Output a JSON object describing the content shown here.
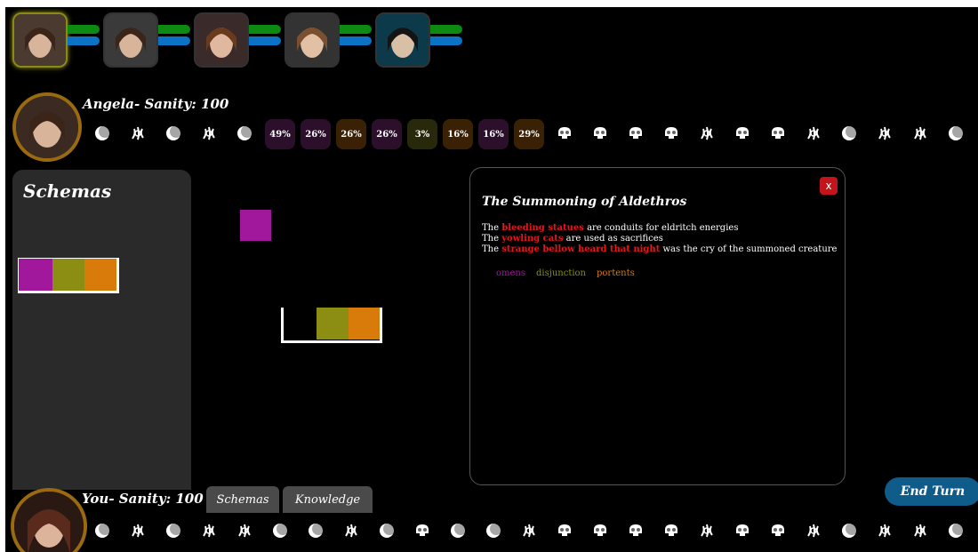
{
  "colors": {
    "purple": "#a2189c",
    "orange": "#d97b0a",
    "olive": "#8b8e12",
    "sanity_green": "#0c8a12",
    "sanity_blue": "#0a73c6",
    "close_red": "#c2141a",
    "end_turn_blue": "#0f5b8a"
  },
  "characters": [
    {
      "name": "Angela",
      "icon": "character-portrait",
      "active": true
    },
    {
      "name": "",
      "icon": "character-portrait",
      "active": false
    },
    {
      "name": "",
      "icon": "character-portrait",
      "active": false
    },
    {
      "name": "",
      "icon": "character-portrait",
      "active": false
    },
    {
      "name": "",
      "icon": "character-portrait",
      "active": false
    }
  ],
  "opponent": {
    "label": "Angela- Sanity: 100",
    "cards": [
      {
        "kind": "moon",
        "color": "purple"
      },
      {
        "kind": "tentacle",
        "color": "orange"
      },
      {
        "kind": "moon",
        "color": "purple"
      },
      {
        "kind": "tentacle",
        "color": "orange"
      },
      {
        "kind": "moon",
        "color": "purple"
      },
      {
        "kind": "percent",
        "color": "d-pur",
        "text": "49%"
      },
      {
        "kind": "percent",
        "color": "d-pur",
        "text": "26%"
      },
      {
        "kind": "percent",
        "color": "d-ora",
        "text": "26%"
      },
      {
        "kind": "percent",
        "color": "d-pur",
        "text": "26%"
      },
      {
        "kind": "percent",
        "color": "d-oli",
        "text": "3%"
      },
      {
        "kind": "percent",
        "color": "d-ora",
        "text": "16%"
      },
      {
        "kind": "percent",
        "color": "d-pur",
        "text": "16%"
      },
      {
        "kind": "percent",
        "color": "d-ora",
        "text": "29%"
      },
      {
        "kind": "skull",
        "color": "olive"
      },
      {
        "kind": "skull",
        "color": "olive"
      },
      {
        "kind": "skull",
        "color": "olive"
      },
      {
        "kind": "skull",
        "color": "olive"
      },
      {
        "kind": "tentacle",
        "color": "orange"
      },
      {
        "kind": "skull",
        "color": "olive"
      },
      {
        "kind": "skull",
        "color": "olive"
      },
      {
        "kind": "tentacle",
        "color": "orange"
      },
      {
        "kind": "moon",
        "color": "purple"
      },
      {
        "kind": "tentacle",
        "color": "orange"
      },
      {
        "kind": "tentacle",
        "color": "orange"
      },
      {
        "kind": "moon",
        "color": "purple"
      }
    ]
  },
  "schemas": {
    "title": "Schemas"
  },
  "modal": {
    "title": "The Summoning of Aldethros",
    "close_label": "x",
    "lines": [
      {
        "pre": "The ",
        "highlight": "bleeding statues",
        "post": " are conduits for eldritch energies"
      },
      {
        "pre": "The ",
        "highlight": "yowling cats",
        "post": " are used as sacrifices"
      },
      {
        "pre": "The ",
        "highlight": "strange bellow heard that night",
        "post": " was the cry of the summoned creature"
      }
    ],
    "tags": [
      {
        "label": "omens",
        "color": "#a2189c"
      },
      {
        "label": "disjunction",
        "color": "#8b8e12"
      },
      {
        "label": "portents",
        "color": "#d97b0a"
      }
    ]
  },
  "player": {
    "label": "You- Sanity: 100",
    "tabs": [
      "Schemas",
      "Knowledge"
    ],
    "end_turn": "End Turn",
    "cards": [
      {
        "kind": "moon",
        "color": "purple"
      },
      {
        "kind": "tentacle",
        "color": "orange"
      },
      {
        "kind": "moon",
        "color": "purple"
      },
      {
        "kind": "tentacle",
        "color": "orange"
      },
      {
        "kind": "tentacle",
        "color": "orange"
      },
      {
        "kind": "moon",
        "color": "purple"
      },
      {
        "kind": "moon",
        "color": "purple"
      },
      {
        "kind": "tentacle",
        "color": "orange"
      },
      {
        "kind": "moon",
        "color": "purple"
      },
      {
        "kind": "skull",
        "color": "olive"
      },
      {
        "kind": "moon",
        "color": "purple"
      },
      {
        "kind": "moon",
        "color": "purple"
      },
      {
        "kind": "tentacle",
        "color": "orange"
      },
      {
        "kind": "skull",
        "color": "olive"
      },
      {
        "kind": "skull",
        "color": "olive"
      },
      {
        "kind": "skull",
        "color": "olive"
      },
      {
        "kind": "skull",
        "color": "olive"
      },
      {
        "kind": "tentacle",
        "color": "orange"
      },
      {
        "kind": "skull",
        "color": "olive"
      },
      {
        "kind": "skull",
        "color": "olive"
      },
      {
        "kind": "tentacle",
        "color": "orange"
      },
      {
        "kind": "moon",
        "color": "purple"
      },
      {
        "kind": "tentacle",
        "color": "orange"
      },
      {
        "kind": "tentacle",
        "color": "orange"
      },
      {
        "kind": "moon",
        "color": "purple"
      }
    ]
  }
}
